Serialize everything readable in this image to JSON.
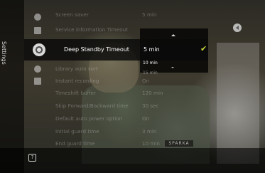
{
  "sidebar": {
    "label": "Settings"
  },
  "settings": {
    "rows_above": [
      {
        "label": "Screen saver",
        "value": "5 min"
      },
      {
        "label": "Service information Timeout",
        "value": ""
      }
    ],
    "selected": {
      "label": "Deep Standby Timeout",
      "value": "5 min"
    },
    "rows_below": [
      {
        "label": "Library auto sort",
        "value": ""
      },
      {
        "label": "Instant recording",
        "value": "On"
      },
      {
        "label": "Timeshift buffer",
        "value": "120 min"
      },
      {
        "label": "Skip Forward/Backward time",
        "value": "30 sec"
      },
      {
        "label": "Default auto power option",
        "value": "On"
      },
      {
        "label": "Initial guard time",
        "value": "3 min"
      },
      {
        "label": "End guard time",
        "value": "10 min"
      }
    ]
  },
  "dropdown": {
    "options": [
      "10 min",
      "15 min"
    ]
  },
  "video": {
    "name_tag": "SPARKA"
  },
  "icons": {
    "sidebar": [
      "clock-icon",
      "tv-icon",
      "gear-icon",
      "record-icon",
      "folder-icon"
    ],
    "help": "help-icon",
    "check": "check-icon",
    "corner": "back-icon"
  },
  "colors": {
    "accent": "#c9d63a"
  }
}
